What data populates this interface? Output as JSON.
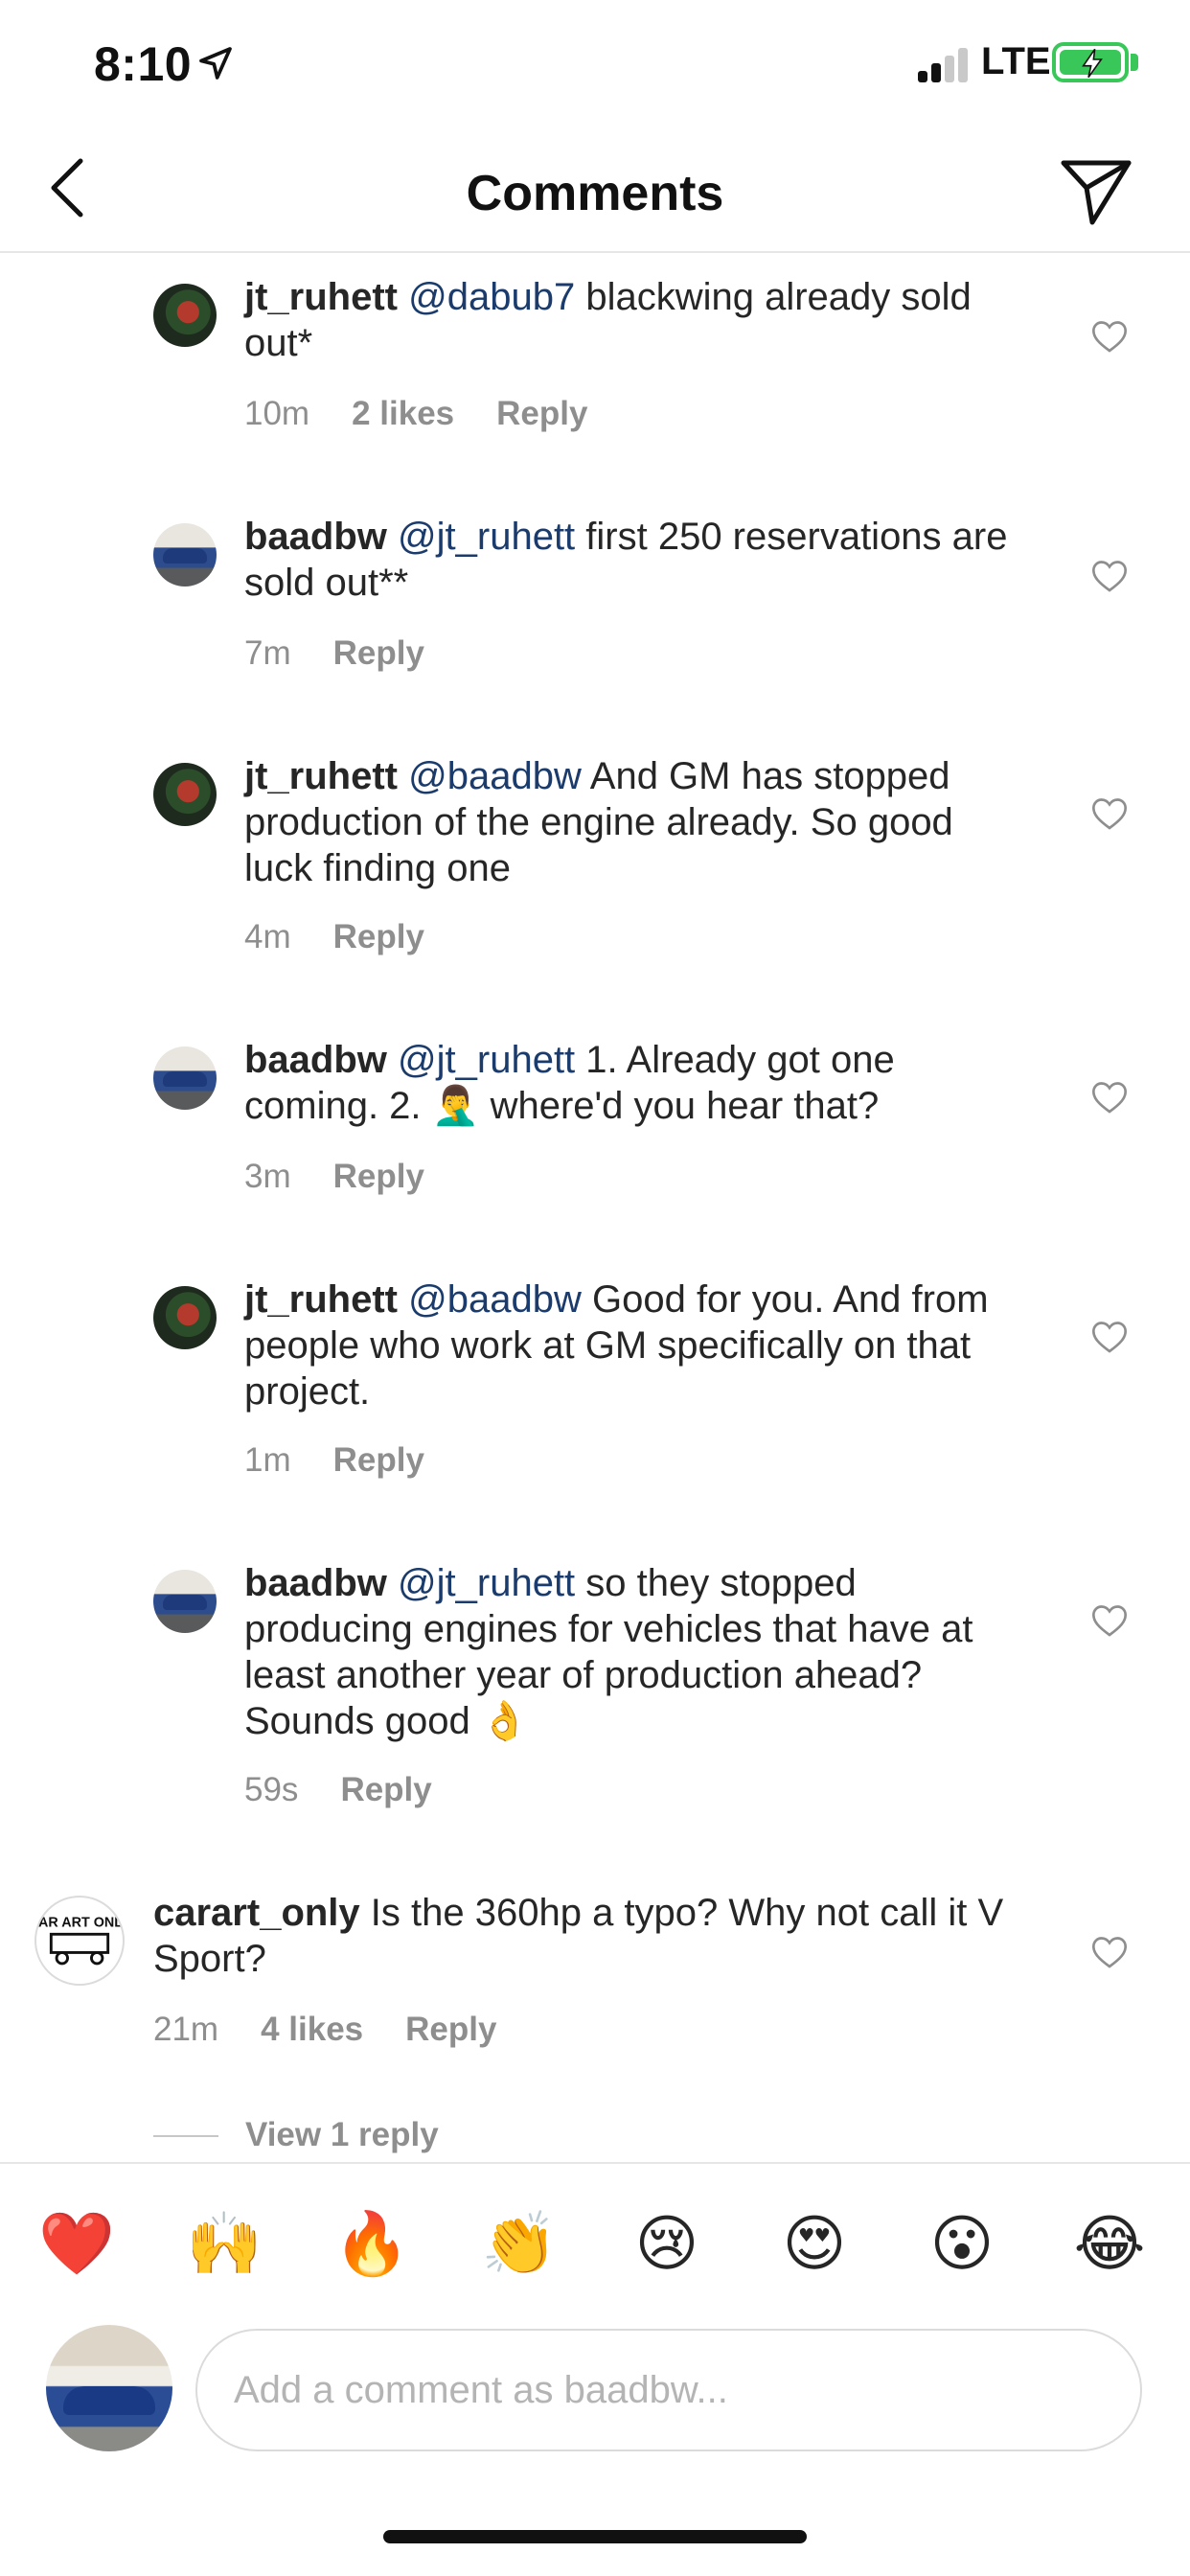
{
  "status_bar": {
    "time": "8:10",
    "carrier": "LTE",
    "battery_color": "#39c759"
  },
  "header": {
    "title": "Comments"
  },
  "comments": [
    {
      "username": "jt_ruhett",
      "mention": "@dabub7",
      "text": " blackwing already sold out*",
      "time": "10m",
      "likes": "2 likes",
      "reply": "Reply"
    },
    {
      "username": "baadbw",
      "mention": "@jt_ruhett",
      "text": " first 250 reservations are sold out**",
      "time": "7m",
      "likes": "",
      "reply": "Reply"
    },
    {
      "username": "jt_ruhett",
      "mention": "@baadbw",
      "text": " And GM has stopped production of the engine already. So good luck finding one",
      "time": "4m",
      "likes": "",
      "reply": "Reply"
    },
    {
      "username": "baadbw",
      "mention": "@jt_ruhett",
      "text": " 1. Already got one coming. 2. 🤦‍♂️ where'd you hear that?",
      "time": "3m",
      "likes": "",
      "reply": "Reply"
    },
    {
      "username": "jt_ruhett",
      "mention": "@baadbw",
      "text": " Good for you. And from people who work at GM specifically on that project.",
      "time": "1m",
      "likes": "",
      "reply": "Reply"
    },
    {
      "username": "baadbw",
      "mention": "@jt_ruhett",
      "text": " so they stopped producing engines for vehicles that have at least another year of production ahead? Sounds good 👌",
      "time": "59s",
      "likes": "",
      "reply": "Reply"
    },
    {
      "username": "carart_only",
      "mention": "",
      "text": " Is the 360hp a typo? Why not call it V Sport?",
      "time": "21m",
      "likes": "4 likes",
      "reply": "Reply",
      "avatar_text": "CAR ART ONLY"
    }
  ],
  "view_replies": "View 1 reply",
  "emoji_bar": [
    "❤️",
    "🙌",
    "🔥",
    "👏",
    "😢",
    "😍",
    "😮",
    "😂"
  ],
  "composer": {
    "placeholder": "Add a comment as baadbw..."
  },
  "colors": {
    "mention": "#1a3b6b",
    "meta": "#8e8e8e",
    "text": "#262626"
  }
}
